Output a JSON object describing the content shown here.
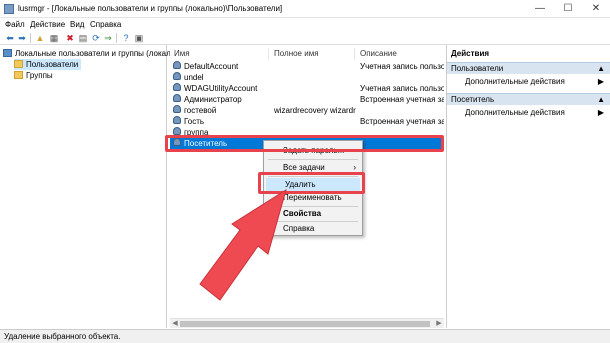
{
  "window": {
    "title": "lusrmgr - [Локальные пользователи и группы (локально)\\Пользователи]",
    "minimize": "—",
    "maximize": "☐",
    "close": "✕"
  },
  "menubar": [
    "Файл",
    "Действие",
    "Вид",
    "Справка"
  ],
  "toolbar": [
    {
      "icon": "back-arrow-icon",
      "glyph": "⬅",
      "color": "#2f6fb7"
    },
    {
      "icon": "forward-arrow-icon",
      "glyph": "➡",
      "color": "#2f6fb7"
    },
    {
      "icon": "up-folder-icon",
      "glyph": "▲",
      "color": "#d2a13a"
    },
    {
      "icon": "show-tree-icon",
      "glyph": "▦",
      "color": "#555555"
    },
    {
      "icon": "delete-icon",
      "glyph": "✖",
      "color": "#d0202a"
    },
    {
      "icon": "properties-icon",
      "glyph": "▤",
      "color": "#555555"
    },
    {
      "icon": "refresh-icon",
      "glyph": "⟳",
      "color": "#2f6fb7"
    },
    {
      "icon": "export-list-icon",
      "glyph": "⇒",
      "color": "#3a8a3a"
    },
    {
      "icon": "help-icon",
      "glyph": "?",
      "color": "#2f6fb7"
    },
    {
      "icon": "console-icon",
      "glyph": "▣",
      "color": "#555555"
    }
  ],
  "tree": {
    "root": "Локальные пользователи и группы (локально)",
    "children": [
      "Пользователи",
      "Группы"
    ]
  },
  "list": {
    "columns": [
      "Имя",
      "Полное имя",
      "Описание"
    ],
    "rows": [
      {
        "name": "DefaultAccount",
        "full": "",
        "desc": "Учетная запись пользо..."
      },
      {
        "name": "undel",
        "full": "",
        "desc": ""
      },
      {
        "name": "WDAGUtilityAccount",
        "full": "",
        "desc": "Учетная запись пользо..."
      },
      {
        "name": "Администратор",
        "full": "",
        "desc": "Встроенная учетная запись..."
      },
      {
        "name": "гостевой",
        "full": "wizardrecovery wizardre...",
        "desc": ""
      },
      {
        "name": "Гость",
        "full": "",
        "desc": "Встроенная учетная запись..."
      },
      {
        "name": "группа",
        "full": "",
        "desc": ""
      },
      {
        "name": "Посетитель",
        "full": "",
        "desc": ""
      }
    ],
    "selected_index": 7
  },
  "context_menu": {
    "items": [
      "Задать пароль...",
      "Все задачи",
      "Удалить",
      "Переименовать",
      "Свойства",
      "Справка"
    ],
    "submenu_arrow": "›"
  },
  "actions": {
    "header": "Действия",
    "sections": [
      {
        "title": "Пользователи",
        "item": "Дополнительные действия"
      },
      {
        "title": "Посетитель",
        "item": "Дополнительные действия"
      }
    ],
    "collapse": "▲",
    "more": "▶"
  },
  "scroll": {
    "left": "◀",
    "right": "▶"
  },
  "status": "Удаление выбранного объекта.",
  "colors": {
    "highlight": "#e8434d",
    "selection": "#0078d7",
    "arrow": "#ef4a52"
  }
}
